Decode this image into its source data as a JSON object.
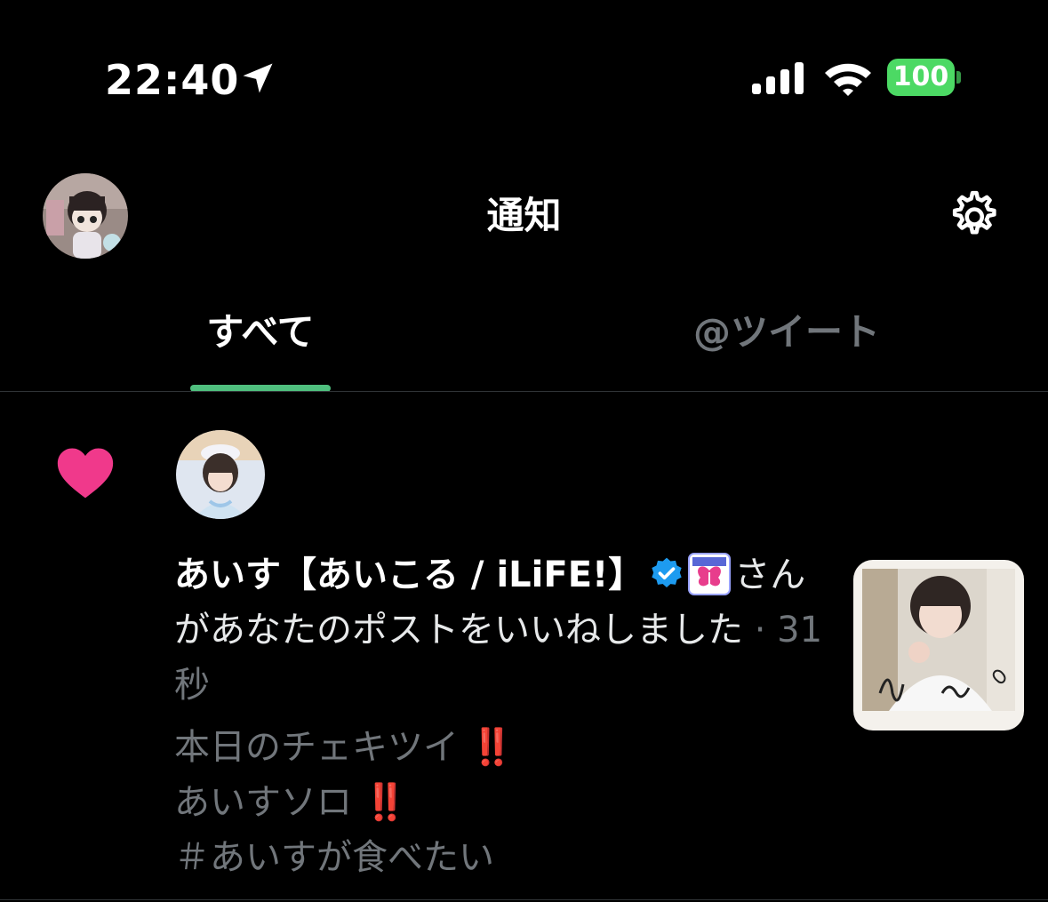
{
  "status_bar": {
    "time": "22:40",
    "battery": "100",
    "icons": [
      "location-arrow-icon",
      "signal-bars-icon",
      "wifi-icon",
      "battery-icon"
    ]
  },
  "header": {
    "title": "通知",
    "icons": [
      "profile-avatar",
      "gear-icon"
    ]
  },
  "tabs": [
    {
      "label": "すべて",
      "active": true
    },
    {
      "label": "@ツイート",
      "active": false
    }
  ],
  "notification": {
    "type": "like",
    "user_name": "あいす【あいこる / iLiFE!】",
    "action_text": "さんがあなたのポストをいいねしました",
    "separator": " · ",
    "time_ago": "31秒",
    "post_lines": [
      "本日のチェキツイ",
      "あいすソロ",
      "＃あいすが食べたい"
    ],
    "post_emoji": "‼️",
    "icons": [
      "heart-icon",
      "verified-badge-icon",
      "ilife-badge-icon"
    ]
  },
  "colors": {
    "background": "#000000",
    "accent_tab": "#4fbf7e",
    "like_heart": "#f0398b",
    "verified": "#1d9bf0",
    "battery": "#4cd964",
    "muted_text": "#71767b"
  }
}
